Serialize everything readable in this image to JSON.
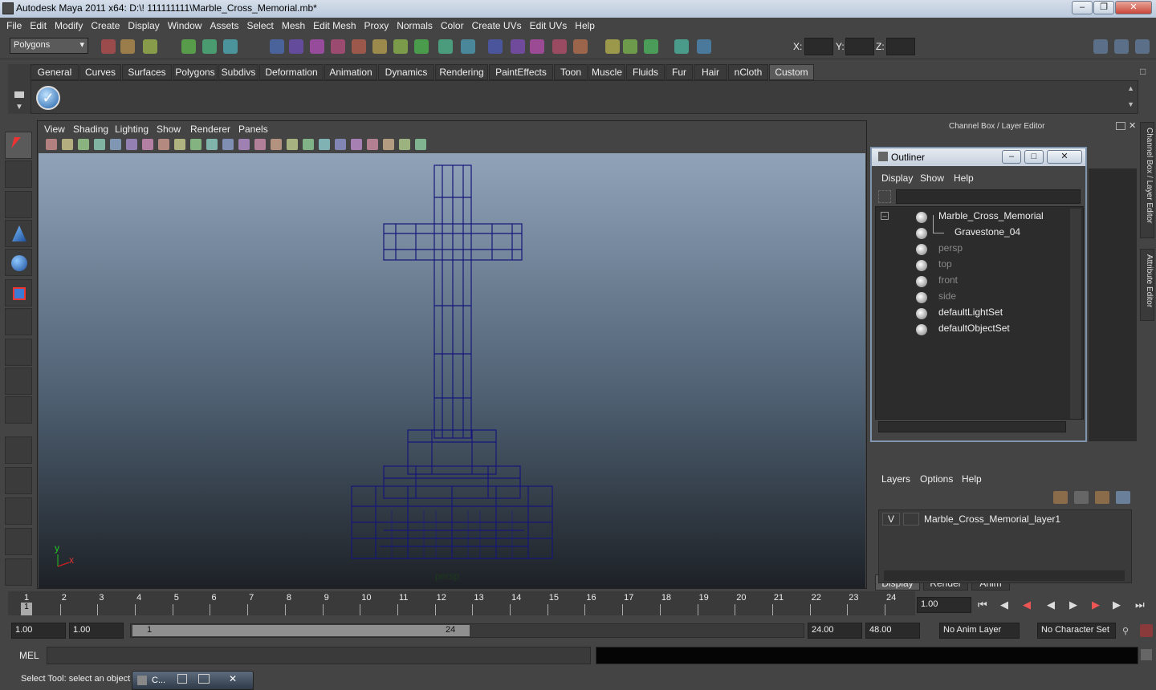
{
  "window": {
    "title": "Autodesk Maya 2011 x64: D:\\! 111111111\\Marble_Cross_Memorial.mb*"
  },
  "menu": [
    "File",
    "Edit",
    "Modify",
    "Create",
    "Display",
    "Window",
    "Assets",
    "Select",
    "Mesh",
    "Edit Mesh",
    "Proxy",
    "Normals",
    "Color",
    "Create UVs",
    "Edit UVs",
    "Help"
  ],
  "toolbar": {
    "mode": "Polygons",
    "x_label": "X:",
    "y_label": "Y:",
    "z_label": "Z:"
  },
  "shelf_tabs": [
    "General",
    "Curves",
    "Surfaces",
    "Polygons",
    "Subdivs",
    "Deformation",
    "Animation",
    "Dynamics",
    "Rendering",
    "PaintEffects",
    "Toon",
    "Muscle",
    "Fluids",
    "Fur",
    "Hair",
    "nCloth",
    "Custom"
  ],
  "shelf_active": "Custom",
  "viewport": {
    "menu": [
      "View",
      "Shading",
      "Lighting",
      "Show",
      "Renderer",
      "Panels"
    ],
    "camera_label": "persp",
    "axis_y": "y",
    "axis_x": "x"
  },
  "channel_box": {
    "title": "Channel Box / Layer Editor",
    "side_tab_1": "Channel Box / Layer Editor",
    "side_tab_2": "Attribute Editor"
  },
  "outliner": {
    "title": "Outliner",
    "menu": [
      "Display",
      "Show",
      "Help"
    ],
    "items": [
      {
        "label": "Marble_Cross_Memorial",
        "dim": false
      },
      {
        "label": "Gravestone_04",
        "dim": false
      },
      {
        "label": "persp",
        "dim": true
      },
      {
        "label": "top",
        "dim": true
      },
      {
        "label": "front",
        "dim": true
      },
      {
        "label": "side",
        "dim": true
      },
      {
        "label": "defaultLightSet",
        "dim": false
      },
      {
        "label": "defaultObjectSet",
        "dim": false
      }
    ]
  },
  "layer_editor": {
    "tabs": [
      "Display",
      "Render",
      "Anim"
    ],
    "menu": [
      "Layers",
      "Options",
      "Help"
    ],
    "visibility": "V",
    "layer_name": "Marble_Cross_Memorial_layer1"
  },
  "timeline": {
    "ticks": [
      "1",
      "2",
      "3",
      "4",
      "5",
      "6",
      "7",
      "8",
      "9",
      "10",
      "11",
      "12",
      "13",
      "14",
      "15",
      "16",
      "17",
      "18",
      "19",
      "20",
      "21",
      "22",
      "23",
      "24"
    ],
    "current_marker": "1",
    "current_time": "1.00"
  },
  "range": {
    "start": "1.00",
    "inner_start": "1.00",
    "slider_start": "1",
    "slider_end": "24",
    "end": "24.00",
    "outer_end": "48.00",
    "anim_layer": "No Anim Layer",
    "char_set": "No Character Set"
  },
  "command": {
    "label": "MEL"
  },
  "status": {
    "help": "Select Tool: select an object",
    "mini_window": "C..."
  }
}
